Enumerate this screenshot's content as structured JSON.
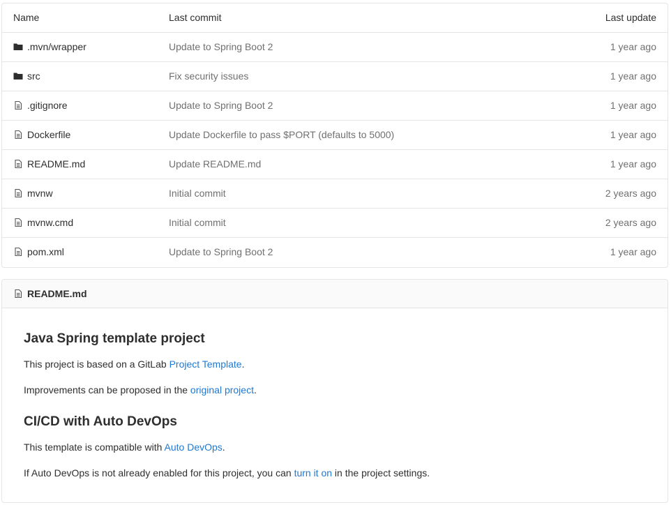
{
  "file_table": {
    "headers": {
      "name": "Name",
      "last_commit": "Last commit",
      "last_update": "Last update"
    },
    "rows": [
      {
        "type": "folder",
        "name": ".mvn/wrapper",
        "commit": "Update to Spring Boot 2",
        "updated": "1 year ago"
      },
      {
        "type": "folder",
        "name": "src",
        "commit": "Fix security issues",
        "updated": "1 year ago"
      },
      {
        "type": "file",
        "name": ".gitignore",
        "commit": "Update to Spring Boot 2",
        "updated": "1 year ago"
      },
      {
        "type": "file",
        "name": "Dockerfile",
        "commit": "Update Dockerfile to pass $PORT (defaults to 5000)",
        "updated": "1 year ago"
      },
      {
        "type": "file",
        "name": "README.md",
        "commit": "Update README.md",
        "updated": "1 year ago"
      },
      {
        "type": "file",
        "name": "mvnw",
        "commit": "Initial commit",
        "updated": "2 years ago"
      },
      {
        "type": "file",
        "name": "mvnw.cmd",
        "commit": "Initial commit",
        "updated": "2 years ago"
      },
      {
        "type": "file",
        "name": "pom.xml",
        "commit": "Update to Spring Boot 2",
        "updated": "1 year ago"
      }
    ]
  },
  "readme": {
    "file_name": "README.md",
    "heading1": "Java Spring template project",
    "p1_text": "This project is based on a GitLab ",
    "p1_link": "Project Template",
    "p1_end": ".",
    "p2_text": "Improvements can be proposed in the ",
    "p2_link": "original project",
    "p2_end": ".",
    "heading2": "CI/CD with Auto DevOps",
    "p3_text": "This template is compatible with ",
    "p3_link": "Auto DevOps",
    "p3_end": ".",
    "p4_text": "If Auto DevOps is not already enabled for this project, you can ",
    "p4_link": "turn it on",
    "p4_end": " in the project settings."
  },
  "colors": {
    "link": "#1f78d1",
    "muted_text": "#707070",
    "border": "#e5e5e5"
  },
  "icons": {
    "folder": "folder-icon",
    "file": "file-icon"
  }
}
